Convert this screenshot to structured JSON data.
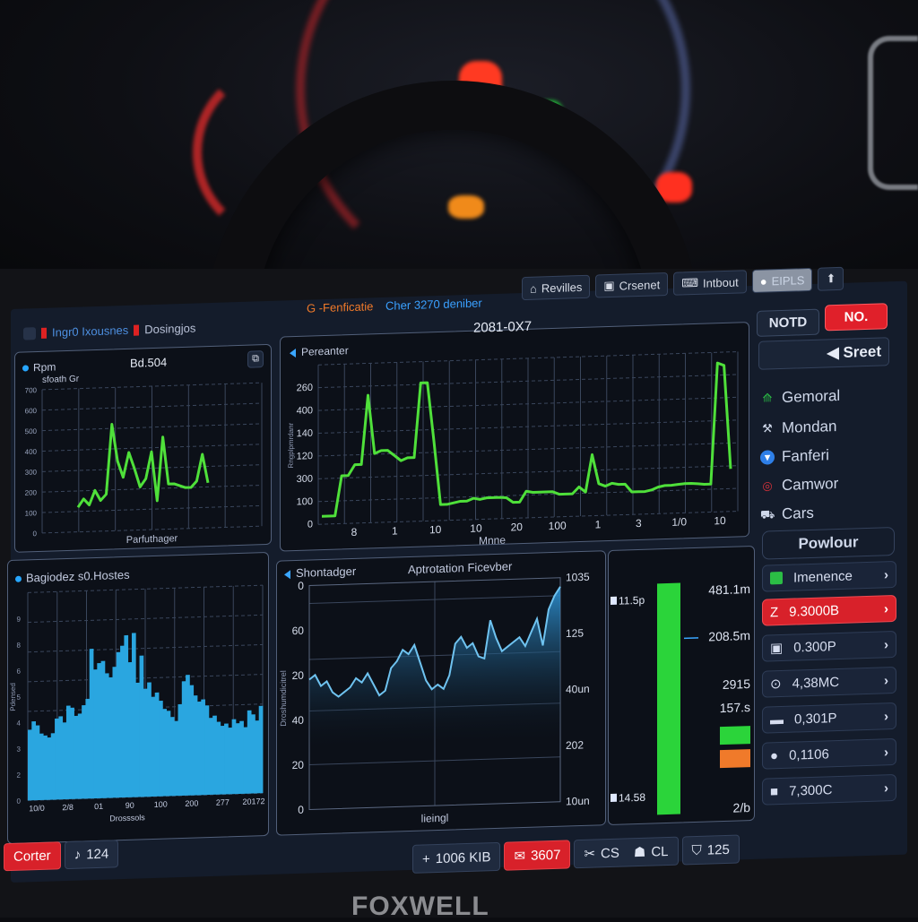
{
  "topbar": {
    "left_label": "Ingr0 Ixousnes",
    "left_label2": "Dosingjos",
    "center_orange": "G -Fenficatie",
    "center_blue": "Cher 3270 deniber",
    "tabs": [
      {
        "icon": "home-icon",
        "label": "Revilles"
      },
      {
        "icon": "square-icon",
        "label": "Crsenet"
      },
      {
        "icon": "keyboard-icon",
        "label": "Intbout"
      },
      {
        "icon": "toggle-icon",
        "label": "EIPLS"
      }
    ],
    "upload_icon": "upload-icon"
  },
  "sidebar": {
    "buttons": {
      "left": "NOTD",
      "right": "NO."
    },
    "street_label": "Sreet",
    "menu": [
      {
        "icon": "tree-icon",
        "label": "Gemoral",
        "color": "#2bbd45"
      },
      {
        "icon": "wrench-icon",
        "label": "Mondan",
        "color": "#e8ecf5"
      },
      {
        "icon": "shield-icon",
        "label": "Fanferi",
        "color": "#2e7fe8"
      },
      {
        "icon": "target-icon",
        "label": "Camwor",
        "color": "#d9323a"
      },
      {
        "icon": "bag-icon",
        "label": "Cars",
        "color": "#e8ecf5"
      }
    ],
    "section_label": "Powlour",
    "rows": [
      {
        "icon": "green-square-icon",
        "label": "Imenence",
        "active": false
      },
      {
        "icon": "z-icon",
        "label": "9.3000B",
        "active": true
      },
      {
        "icon": "box-icon",
        "label": "0.300P",
        "active": false
      },
      {
        "icon": "pin-icon",
        "label": "4,38MC",
        "active": false
      },
      {
        "icon": "chat-icon",
        "label": "0,301P",
        "active": false
      },
      {
        "icon": "circle-icon",
        "label": "0,1106",
        "active": false
      },
      {
        "icon": "folder-icon",
        "label": "7,300C",
        "active": false
      }
    ]
  },
  "bottom_bar": {
    "left": [
      {
        "label": "Corter",
        "active": true
      },
      {
        "label": "124",
        "icon": "phone-icon"
      }
    ],
    "right": [
      {
        "icon": "plus-icon",
        "label": "1006 KIB"
      },
      {
        "icon": "chat-icon",
        "label": "3607",
        "active": true
      },
      {
        "icon": "tools-icon",
        "label": "CS"
      },
      {
        "icon": "person-icon",
        "label": "CL"
      },
      {
        "icon": "shield-icon",
        "label": "125"
      }
    ]
  },
  "brand": "FOXWELL",
  "colors": {
    "green": "#4fe03a",
    "blue": "#2aa6e0",
    "red": "#d8212a",
    "orange": "#f07a2a"
  },
  "chart_data": [
    {
      "id": "top-left",
      "type": "line",
      "title": "Bd.504",
      "legend": "Rpm",
      "subtitle": "sfoath Gr",
      "xlabel": "Parfuthager",
      "y_ticks": [
        "0",
        "100",
        "200",
        "300",
        "400",
        "500",
        "600",
        "700"
      ],
      "ylim": [
        0,
        700
      ],
      "values": [
        120,
        160,
        130,
        200,
        150,
        180,
        520,
        340,
        260,
        380,
        300,
        210,
        250,
        380,
        140,
        450,
        220,
        220,
        210,
        200,
        200,
        230,
        360,
        220
      ],
      "color": "#4fe03a"
    },
    {
      "id": "top-center",
      "type": "line",
      "title": "2081-0X7",
      "legend": "Pereanter",
      "xlabel": "Mnne",
      "ylabel": "Rngplpmrdanr",
      "y_ticks": [
        "0",
        "100",
        "300",
        "120",
        "140",
        "400",
        "260"
      ],
      "x_ticks": [
        "8",
        "1",
        "10",
        "10",
        "20",
        "100",
        "1",
        "3",
        "1/0",
        "10"
      ],
      "ylim": [
        0,
        600
      ],
      "values": [
        30,
        30,
        30,
        180,
        180,
        220,
        220,
        480,
        260,
        270,
        270,
        250,
        230,
        240,
        240,
        520,
        520,
        300,
        60,
        60,
        65,
        70,
        70,
        80,
        75,
        80,
        80,
        80,
        78,
        60,
        60,
        100,
        95,
        95,
        95,
        95,
        85,
        85,
        85,
        110,
        90,
        230,
        120,
        110,
        120,
        115,
        115,
        85,
        85,
        85,
        90,
        100,
        105,
        105,
        108,
        110,
        110,
        108,
        105,
        105,
        560,
        550,
        160
      ],
      "color": "#4fe03a"
    },
    {
      "id": "bottom-left",
      "type": "bar",
      "title": "Bagiodez s0.Hostes",
      "xlabel": "Drosssols",
      "ylabel": "Pdensed",
      "x_ticks": [
        "10/0",
        "2/8",
        "01",
        "90",
        "100",
        "200",
        "277",
        "20172"
      ],
      "y_ticks": [
        "0",
        "2",
        "3",
        "4",
        "5",
        "6",
        "8",
        "9"
      ],
      "ylim": [
        0,
        10
      ],
      "values": [
        3.4,
        3.8,
        3.6,
        3.2,
        3.1,
        3.0,
        3.2,
        3.9,
        4.0,
        3.7,
        4.5,
        4.4,
        4.0,
        4.1,
        4.5,
        4.8,
        7.2,
        6.2,
        6.5,
        6.6,
        6.0,
        5.8,
        6.3,
        7.0,
        7.3,
        7.8,
        6.5,
        7.9,
        5.5,
        6.8,
        5.2,
        5.5,
        4.8,
        5.0,
        4.6,
        4.2,
        4.1,
        3.8,
        3.6,
        4.4,
        5.5,
        5.8,
        5.3,
        4.8,
        4.5,
        4.6,
        4.3,
        3.7,
        3.8,
        3.5,
        3.3,
        3.4,
        3.2,
        3.6,
        3.4,
        3.5,
        3.2,
        4.0,
        3.8,
        3.5,
        4.2
      ],
      "color": "#2aa6e0"
    },
    {
      "id": "bottom-center",
      "type": "area",
      "legend": "Shontadger",
      "title": "Aptrotation Ficevber",
      "xlabel": "lieingl",
      "ylabel": "Droshumdicitrel",
      "y_ticks_left": [
        "0",
        "20",
        "40",
        "20",
        "60",
        "0"
      ],
      "y_ticks_right": [
        "10un",
        "202",
        "40un",
        "125",
        "1035"
      ],
      "ylim": [
        0,
        100
      ],
      "values": [
        58,
        60,
        55,
        57,
        52,
        50,
        52,
        54,
        58,
        56,
        60,
        55,
        50,
        52,
        62,
        65,
        70,
        68,
        72,
        64,
        56,
        52,
        54,
        52,
        58,
        72,
        75,
        70,
        72,
        66,
        65,
        82,
        74,
        68,
        70,
        72,
        74,
        70,
        76,
        82,
        70,
        86,
        92,
        96
      ],
      "color": "#6fc3f0"
    },
    {
      "id": "bottom-right",
      "type": "bar",
      "labels_left": [
        "11.5p",
        "14.58"
      ],
      "labels_right": [
        "481.1m",
        "208.5m",
        "2915",
        "157.s",
        "2/b"
      ],
      "value_fraction": 1.0,
      "legend_swatches": [
        "#2bd43a",
        "#f07a2a"
      ],
      "color": "#2bd43a"
    }
  ]
}
